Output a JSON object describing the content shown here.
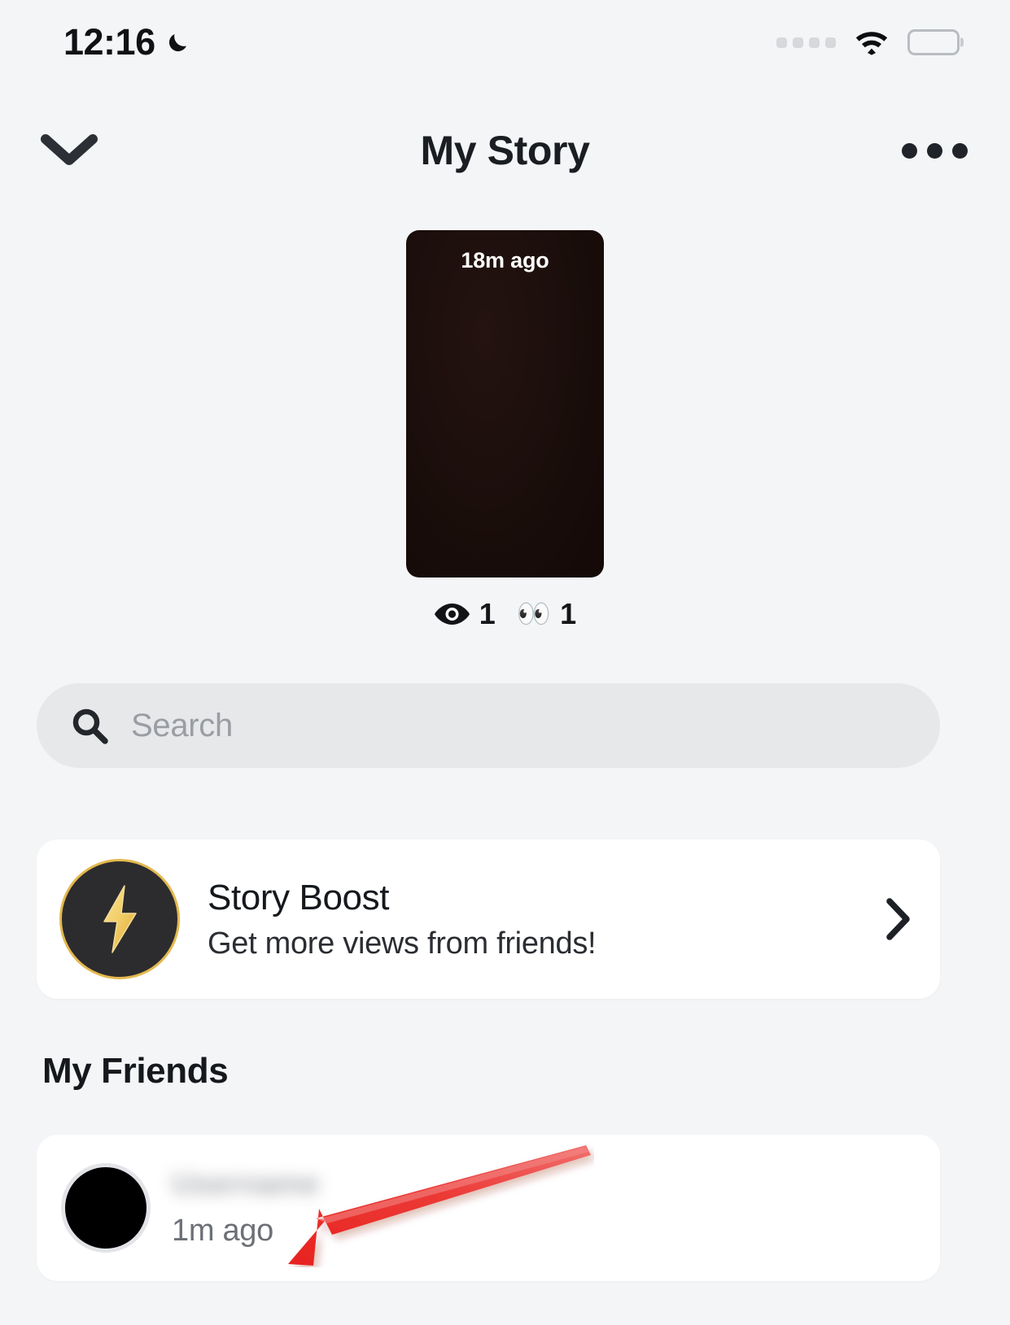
{
  "status_bar": {
    "time": "12:16",
    "dnd_icon": "moon-icon",
    "signal_icon": "signal-dots-icon",
    "wifi_icon": "wifi-icon",
    "battery_icon": "battery-icon",
    "battery_level_pct": 88
  },
  "header": {
    "back_icon": "chevron-down-icon",
    "title": "My Story",
    "more_icon": "more-options-icon"
  },
  "story": {
    "timestamp": "18m ago",
    "thumbnail_color": "#190d0a",
    "stats": [
      {
        "icon": "eye-icon",
        "count": "1"
      },
      {
        "icon": "eyes-emoji-icon",
        "glyph": "👀",
        "count": "1"
      }
    ]
  },
  "search": {
    "icon": "search-icon",
    "placeholder": "Search",
    "value": ""
  },
  "story_boost": {
    "icon": "lightning-bolt-icon",
    "title": "Story Boost",
    "subtitle": "Get more views from friends!",
    "chevron_icon": "chevron-right-icon",
    "accent_color": "#e3b84e"
  },
  "friends_section": {
    "heading": "My Friends",
    "items": [
      {
        "avatar": "friend-avatar",
        "name": "",
        "name_redacted": true,
        "timestamp": "1m ago"
      }
    ]
  },
  "annotation": {
    "type": "arrow",
    "color": "#e8221f",
    "points_to": "friend-list-item"
  }
}
